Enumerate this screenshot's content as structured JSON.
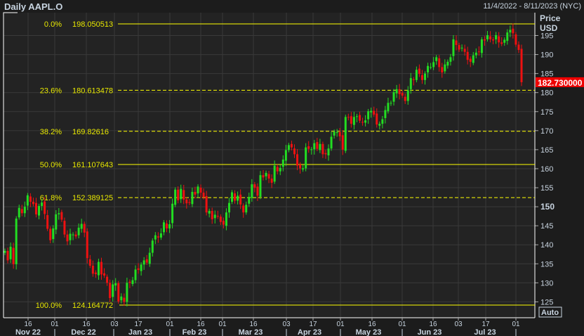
{
  "header": {
    "title": "Daily AAPL.O",
    "date_range": "11/4/2022 - 8/11/2023 (NYC)"
  },
  "axis": {
    "price_label": "Price",
    "currency": "USD",
    "auto_label": "Auto",
    "last_price": "182.730000"
  },
  "colors": {
    "up": "#22dd22",
    "down": "#ee1111",
    "fib": "#ffff00",
    "last_price_bg": "#ee0000"
  },
  "chart_data": {
    "type": "candlestick",
    "title": "Daily AAPL.O",
    "ylabel": "Price USD",
    "ylim": [
      124.164772,
      198.050513
    ],
    "yticks": [
      125,
      130,
      135,
      140,
      145,
      150,
      155,
      160,
      165,
      170,
      175,
      180,
      185,
      190,
      195
    ],
    "xticks": [
      {
        "label": "16",
        "x": 40
      },
      {
        "label": "01",
        "x": 78
      },
      {
        "label": "16",
        "x": 123
      },
      {
        "label": "03",
        "x": 163
      },
      {
        "label": "17",
        "x": 197
      },
      {
        "label": "01",
        "x": 242
      },
      {
        "label": "16",
        "x": 286
      },
      {
        "label": "01",
        "x": 317
      },
      {
        "label": "16",
        "x": 361
      },
      {
        "label": "03",
        "x": 408
      },
      {
        "label": "17",
        "x": 446
      },
      {
        "label": "01",
        "x": 485
      },
      {
        "label": "16",
        "x": 530
      },
      {
        "label": "01",
        "x": 573
      },
      {
        "label": "16",
        "x": 617
      },
      {
        "label": "03",
        "x": 653
      },
      {
        "label": "17",
        "x": 692
      },
      {
        "label": "01",
        "x": 735
      }
    ],
    "months": [
      "Nov 22",
      "Dec 22",
      "Jan 23",
      "Feb 23",
      "Mar 23",
      "Apr 23",
      "May 23",
      "Jun 23",
      "Jul 23"
    ],
    "fib_levels": [
      {
        "pct": "0.0%",
        "value": "198.050513",
        "price": 198.050513,
        "style": "solid"
      },
      {
        "pct": "23.6%",
        "value": "180.613478",
        "price": 180.613478,
        "style": "dashed"
      },
      {
        "pct": "38.2%",
        "value": "169.82616",
        "price": 169.82616,
        "style": "dashed"
      },
      {
        "pct": "50.0%",
        "value": "161.107643",
        "price": 161.107643,
        "style": "solid"
      },
      {
        "pct": "61.8%",
        "value": "152.389125",
        "price": 152.389125,
        "style": "dashed"
      },
      {
        "pct": "100.0%",
        "value": "124.164772",
        "price": 124.164772,
        "style": "solid"
      }
    ],
    "closes": [
      138.4,
      135.9,
      139.5,
      134.9,
      146.9,
      149.7,
      148.3,
      150.0,
      153.0,
      151.3,
      150.7,
      148.0,
      150.2,
      151.1,
      148.1,
      144.2,
      141.2,
      144.3,
      148.0,
      148.3,
      146.6,
      142.7,
      140.9,
      142.9,
      142.7,
      142.2,
      144.5,
      145.5,
      143.2,
      136.5,
      134.5,
      132.4,
      132.3,
      135.5,
      132.2,
      131.9,
      130.0,
      126.0,
      129.6,
      129.9,
      125.1,
      126.4,
      125.0,
      130.0,
      130.0,
      130.7,
      133.5,
      133.4,
      134.8,
      135.9,
      135.3,
      137.9,
      141.1,
      142.5,
      141.9,
      143.0,
      145.9,
      144.3,
      145.4,
      150.8,
      154.5,
      151.7,
      154.7,
      151.9,
      150.9,
      151.0,
      153.9,
      153.2,
      155.3,
      153.7,
      152.5,
      148.5,
      148.9,
      146.7,
      147.9,
      147.4,
      146.0,
      145.3,
      148.5,
      151.0,
      153.8,
      151.6,
      152.9,
      150.6,
      148.5,
      150.5,
      152.6,
      155.9,
      155.0,
      152.9,
      158.3,
      157.7,
      158.9,
      157.4,
      156.3,
      160.8,
      159.3,
      160.2,
      162.4,
      164.9,
      166.2,
      165.6,
      163.8,
      160.8,
      160.1,
      160.1,
      165.6,
      165.2,
      165.1,
      166.7,
      165.2,
      166.5,
      163.8,
      163.8,
      165.3,
      168.4,
      169.7,
      169.6,
      168.5,
      165.0,
      173.6,
      173.5,
      171.8,
      173.6,
      173.8,
      172.6,
      172.1,
      172.7,
      175.1,
      175.2,
      174.2,
      171.6,
      171.8,
      173.0,
      175.4,
      177.3,
      177.3,
      180.1,
      180.9,
      179.6,
      179.2,
      177.8,
      180.6,
      183.8,
      183.3,
      186.0,
      184.9,
      183.3,
      185.0,
      187.0,
      186.7,
      188.0,
      189.3,
      186.7,
      185.3,
      187.4,
      188.1,
      189.3,
      194.0,
      192.5,
      191.3,
      191.8,
      190.7,
      188.6,
      188.1,
      189.8,
      190.5,
      190.7,
      193.99,
      193.7,
      195.1,
      193.99,
      193.7,
      195.1,
      193.2,
      192.8,
      193.9,
      195.8,
      196.5,
      195.6,
      192.6,
      191.2,
      182.73
    ]
  }
}
